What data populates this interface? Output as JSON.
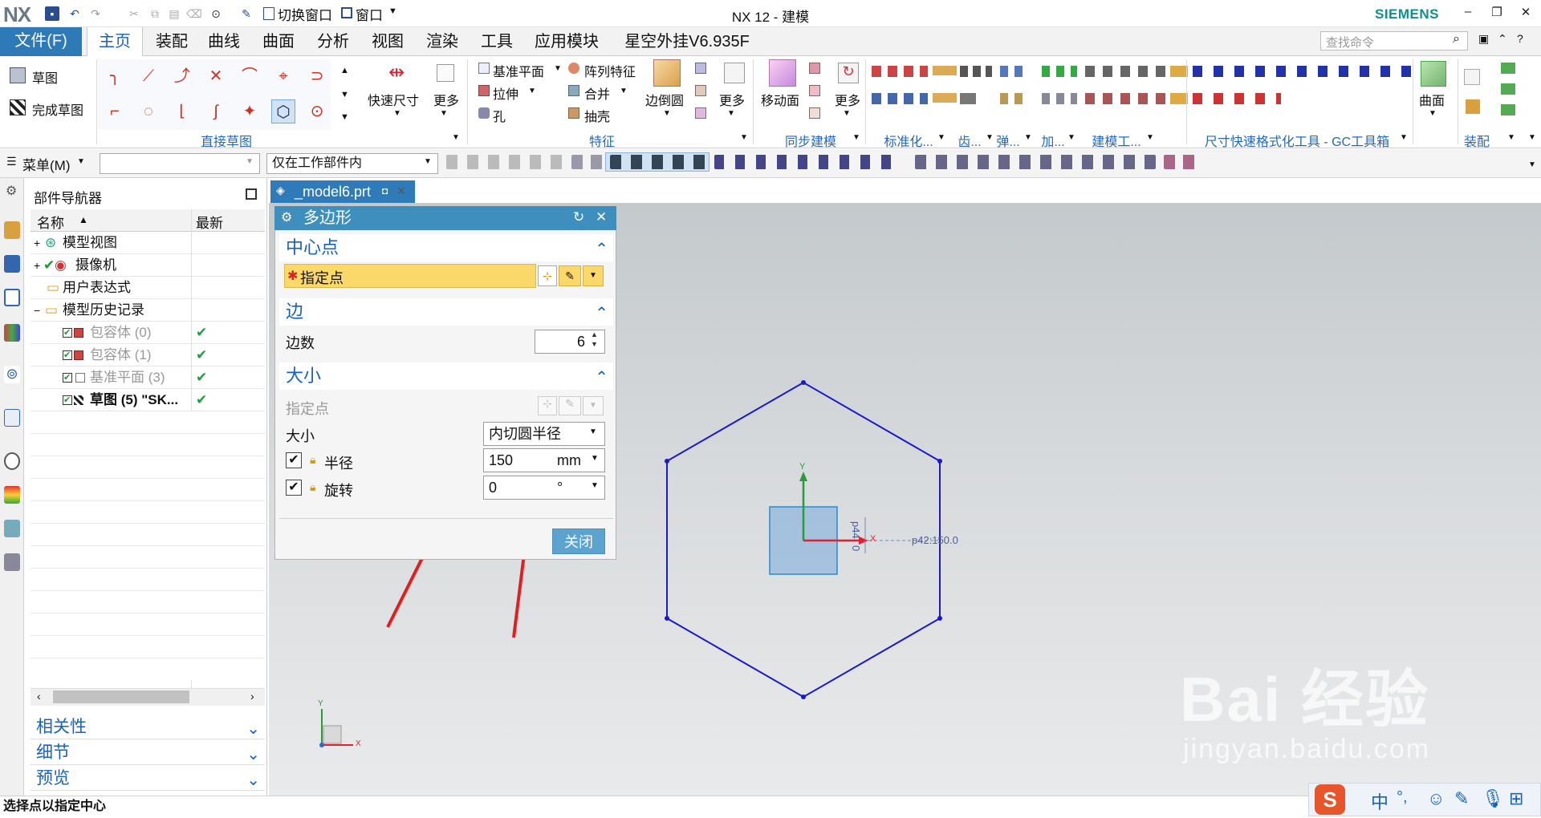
{
  "app": {
    "logo": "NX",
    "window_title": "NX 12 - 建模",
    "brand": "SIEMENS",
    "switch_window": "切换窗口",
    "window_menu": "窗口"
  },
  "menubar": {
    "file": "文件(F)",
    "tabs": [
      "主页",
      "装配",
      "曲线",
      "曲面",
      "分析",
      "视图",
      "渲染",
      "工具",
      "应用模块",
      "星空外挂V6.935F"
    ],
    "search_placeholder": "查找命令"
  },
  "ribbon": {
    "sketch": "草图",
    "finish_sketch": "完成草图",
    "quick_dim": "快速尺寸",
    "more1": "更多",
    "datum_plane": "基准平面",
    "extrude": "拉伸",
    "hole": "孔",
    "pattern_feature": "阵列特征",
    "unite": "合并",
    "shell": "抽壳",
    "edge_blend": "边倒圆",
    "more2": "更多",
    "move_face": "移动面",
    "more3": "更多",
    "surface": "曲面",
    "groups": {
      "direct_sketch": "直接草图",
      "feature": "特征",
      "sync_modeling": "同步建模",
      "standardize": "标准化...",
      "gear": "齿...",
      "spring": "弹...",
      "machining": "加...",
      "modeling_tools": "建模工...",
      "gc_tools": "尺寸快速格式化工具 - GC工具箱",
      "assembly": "装配"
    }
  },
  "toolbar2": {
    "menu": "菜单(M)",
    "filter_empty": "",
    "scope": "仅在工作部件内"
  },
  "navigator": {
    "title": "部件导航器",
    "col_name": "名称",
    "col_latest": "最新",
    "items": [
      {
        "label": "模型视图",
        "latest": ""
      },
      {
        "label": "摄像机",
        "latest": ""
      },
      {
        "label": "用户表达式",
        "latest": ""
      },
      {
        "label": "模型历史记录",
        "latest": ""
      },
      {
        "label": "包容体 (0)",
        "latest": "✔"
      },
      {
        "label": "包容体 (1)",
        "latest": "✔"
      },
      {
        "label": "基准平面 (3)",
        "latest": "✔"
      },
      {
        "label": "草图 (5) \"SK...",
        "latest": "✔"
      }
    ],
    "sections": [
      "相关性",
      "细节",
      "预览"
    ]
  },
  "document_tab": "_model6.prt",
  "dialog": {
    "title": "多边形",
    "center_section": "中心点",
    "specify_point": "指定点",
    "edges_section": "边",
    "edge_count_label": "边数",
    "edge_count": "6",
    "size_section": "大小",
    "size_specify_point": "指定点",
    "size_label": "大小",
    "size_option": "内切圆半径",
    "radius_label": "半径",
    "radius_value": "150",
    "radius_unit": "mm",
    "rotation_label": "旋转",
    "rotation_value": "0",
    "rotation_unit": "°",
    "close": "关闭"
  },
  "viewport": {
    "dim1": "p44",
    "dim1b": "0",
    "dim2": "p42:150.0",
    "axis_y": "Y",
    "axis_x": "X",
    "triad_y": "Y",
    "triad_x": "X",
    "watermark": "Bai 经验",
    "watermark_url": "jingyan.baidu.com"
  },
  "status": {
    "prompt": "选择点以指定中心"
  },
  "ime": {
    "lang": "中",
    "punct": "°,"
  },
  "colors": {
    "accent": "#2d7ab7",
    "hexagon": "#1a1acc",
    "annotation_arrow": "#e02020",
    "required_field": "#fbd86a"
  }
}
